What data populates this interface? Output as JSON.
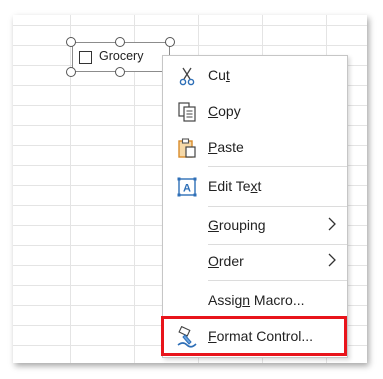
{
  "checkbox_control": {
    "label": "Grocery",
    "checked": false
  },
  "context_menu": {
    "items": [
      {
        "label_pre": "Cu",
        "label_u": "t",
        "label_post": "",
        "icon": "scissors-icon"
      },
      {
        "label_pre": "",
        "label_u": "C",
        "label_post": "opy",
        "icon": "copy-icon"
      },
      {
        "label_pre": "",
        "label_u": "P",
        "label_post": "aste",
        "icon": "paste-icon"
      },
      {
        "label_pre": "Edit Te",
        "label_u": "x",
        "label_post": "t",
        "icon": "edit-text-icon"
      },
      {
        "label_pre": "",
        "label_u": "G",
        "label_post": "rouping",
        "icon": "",
        "submenu": true
      },
      {
        "label_pre": "",
        "label_u": "O",
        "label_post": "rder",
        "icon": "",
        "submenu": true
      },
      {
        "label_pre": "Assig",
        "label_u": "n",
        "label_post": " Macro...",
        "icon": ""
      },
      {
        "label_pre": "",
        "label_u": "F",
        "label_post": "ormat Control...",
        "icon": "format-control-icon",
        "highlighted": true
      }
    ]
  },
  "colors": {
    "highlight": "#e8141b",
    "accent_blue": "#2e6fb7",
    "paste_orange": "#d98c2a"
  }
}
